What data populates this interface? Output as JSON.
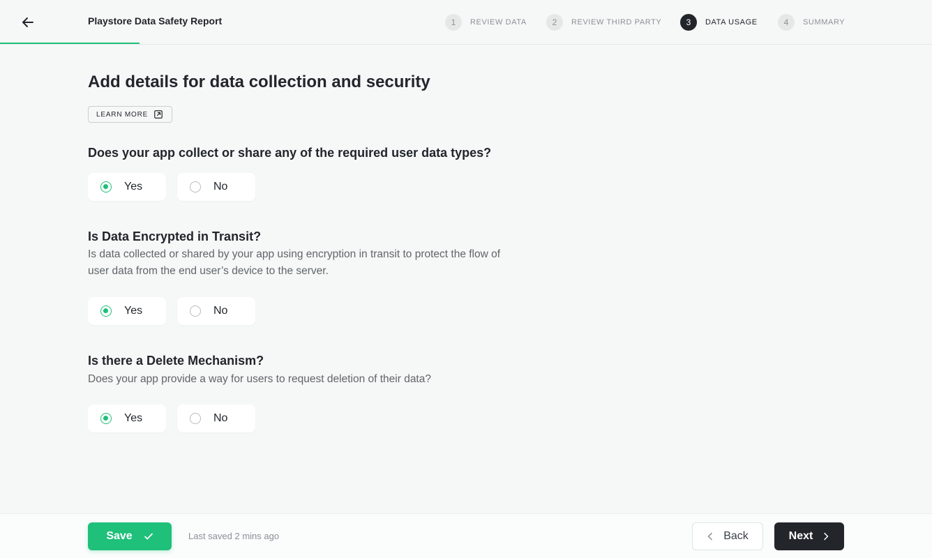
{
  "header": {
    "title": "Playstore Data Safety Report",
    "steps": [
      {
        "number": "1",
        "label": "REVIEW DATA",
        "active": false
      },
      {
        "number": "2",
        "label": "REVIEW THIRD PARTY",
        "active": false
      },
      {
        "number": "3",
        "label": "DATA USAGE",
        "active": true
      },
      {
        "number": "4",
        "label": "SUMMARY",
        "active": false
      }
    ]
  },
  "main": {
    "title": "Add details for data collection and security",
    "learn_more": "LEARN MORE",
    "questions": [
      {
        "title": "Does your app collect or share any of the required user data types?",
        "description": "",
        "options": [
          "Yes",
          "No"
        ],
        "selected": "Yes"
      },
      {
        "title": "Is Data Encrypted in Transit?",
        "description": "Is data collected or shared by your app using encryption in transit to protect the flow of user data from the end user’s device to the server.",
        "options": [
          "Yes",
          "No"
        ],
        "selected": "Yes"
      },
      {
        "title": "Is there a Delete Mechanism?",
        "description": "Does your app provide a way for users to request deletion of their data?",
        "options": [
          "Yes",
          "No"
        ],
        "selected": "Yes"
      }
    ]
  },
  "footer": {
    "save_label": "Save",
    "last_saved": "Last saved 2 mins ago",
    "back_label": "Back",
    "next_label": "Next"
  },
  "colors": {
    "accent": "#1ec07a",
    "dark": "#22262b",
    "background": "#f6f8f7"
  }
}
